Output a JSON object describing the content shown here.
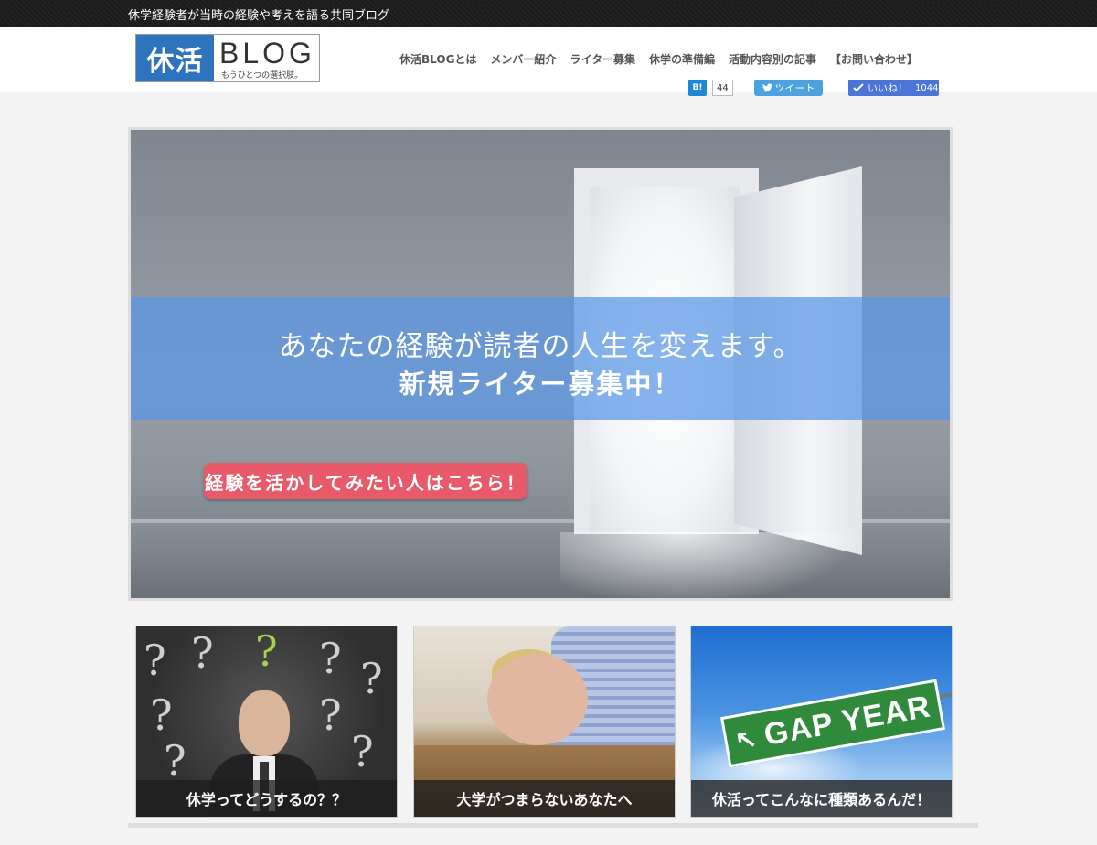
{
  "topbar": {
    "text": "休学経験者が当時の経験や考えを語る共同ブログ"
  },
  "logo": {
    "jp": "休活",
    "en": "BLOG",
    "tagline": "もうひとつの選択肢。"
  },
  "nav": {
    "items": [
      "休活BLOGとは",
      "メンバー紹介",
      "ライター募集",
      "休学の準備編",
      "活動内容別の記事",
      "【お問い合わせ】"
    ]
  },
  "social": {
    "hatena_label": "B!",
    "hatena_count": "44",
    "tweet_label": "ツイート",
    "like_label": "いいね！",
    "like_count": "1044"
  },
  "hero": {
    "line1": "あなたの経験が読者の人生を変えます。",
    "line2": "新規ライター募集中！",
    "cta": "経験を活かしてみたい人はこちら！"
  },
  "cards": [
    {
      "caption": "休学ってどうするの？？"
    },
    {
      "caption": "大学がつまらないあなたへ"
    },
    {
      "caption": "休活ってこんなに種類あるんだ！",
      "sign_text": "GAP YEAR"
    }
  ],
  "colors": {
    "brand_blue": "#2d73bd",
    "cta_red": "#e85a6a",
    "hero_band": "#5896e6"
  }
}
